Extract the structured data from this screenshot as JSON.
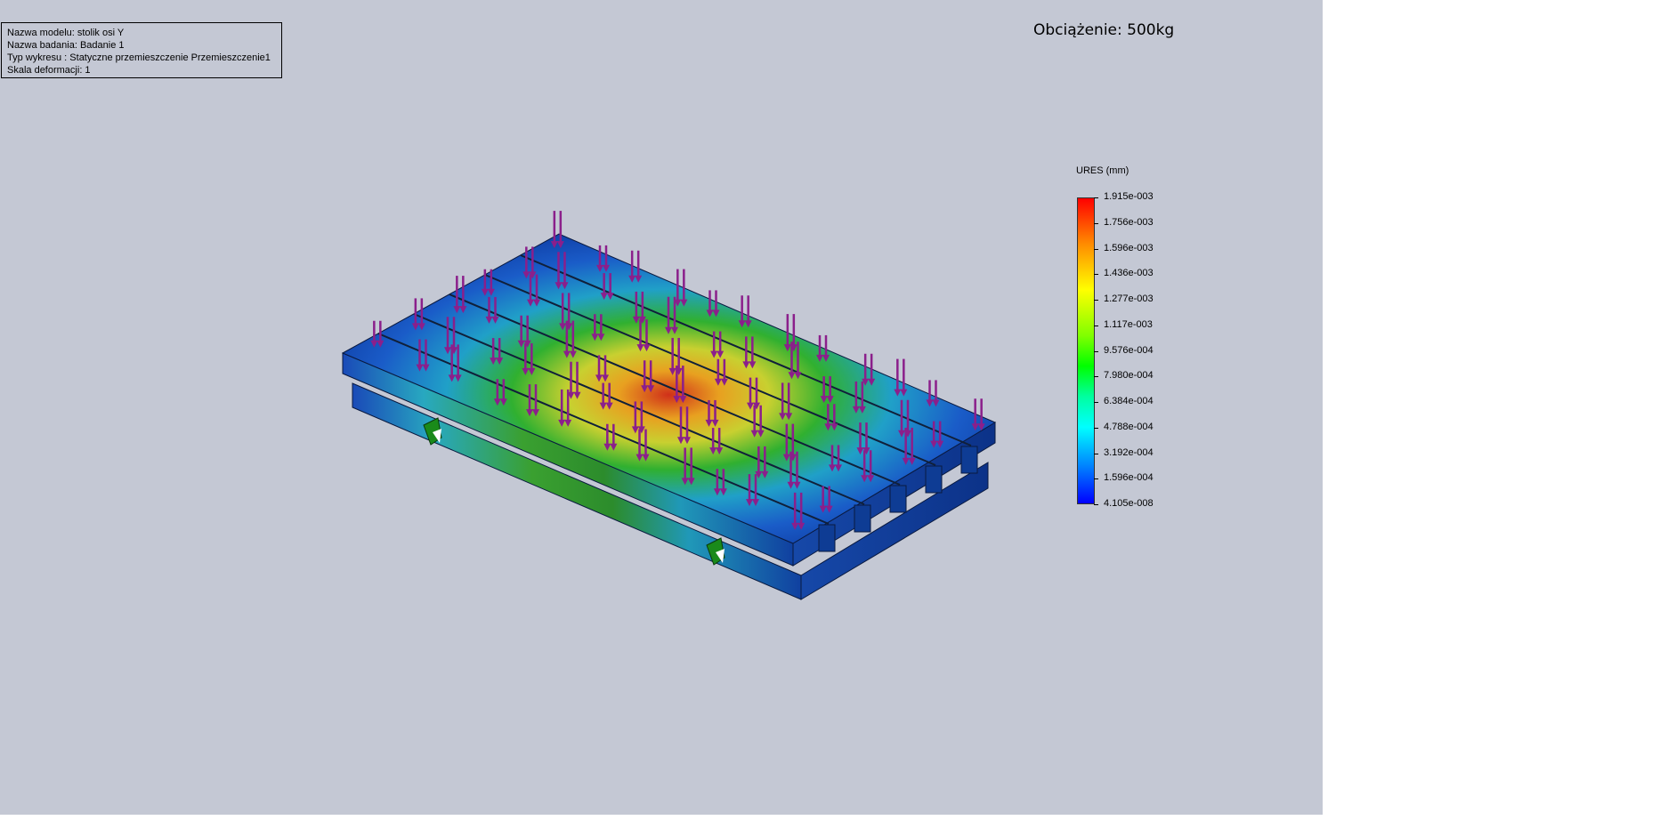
{
  "info": {
    "model_name": "Nazwa modelu: stolik osi Y",
    "study_name": "Nazwa badania: Badanie 1",
    "plot_type": "Typ wykresu : Statyczne przemieszczenie Przemieszczenie1",
    "deformation_scale": "Skala deformacji: 1"
  },
  "load_title": "Obciążenie: 500kg",
  "legend": {
    "title": "URES (mm)",
    "labels": [
      "1.915e-003",
      "1.756e-003",
      "1.596e-003",
      "1.436e-003",
      "1.277e-003",
      "1.117e-003",
      "9.576e-004",
      "7.980e-004",
      "6.384e-004",
      "4.788e-004",
      "3.192e-004",
      "1.596e-004",
      "4.105e-008"
    ]
  },
  "colors": {
    "background": "#c4c8d4",
    "arrow": "#8b1f8b",
    "max": "#ff0000",
    "min": "#0000ff"
  },
  "model": {
    "icon": "fixture-icon"
  }
}
